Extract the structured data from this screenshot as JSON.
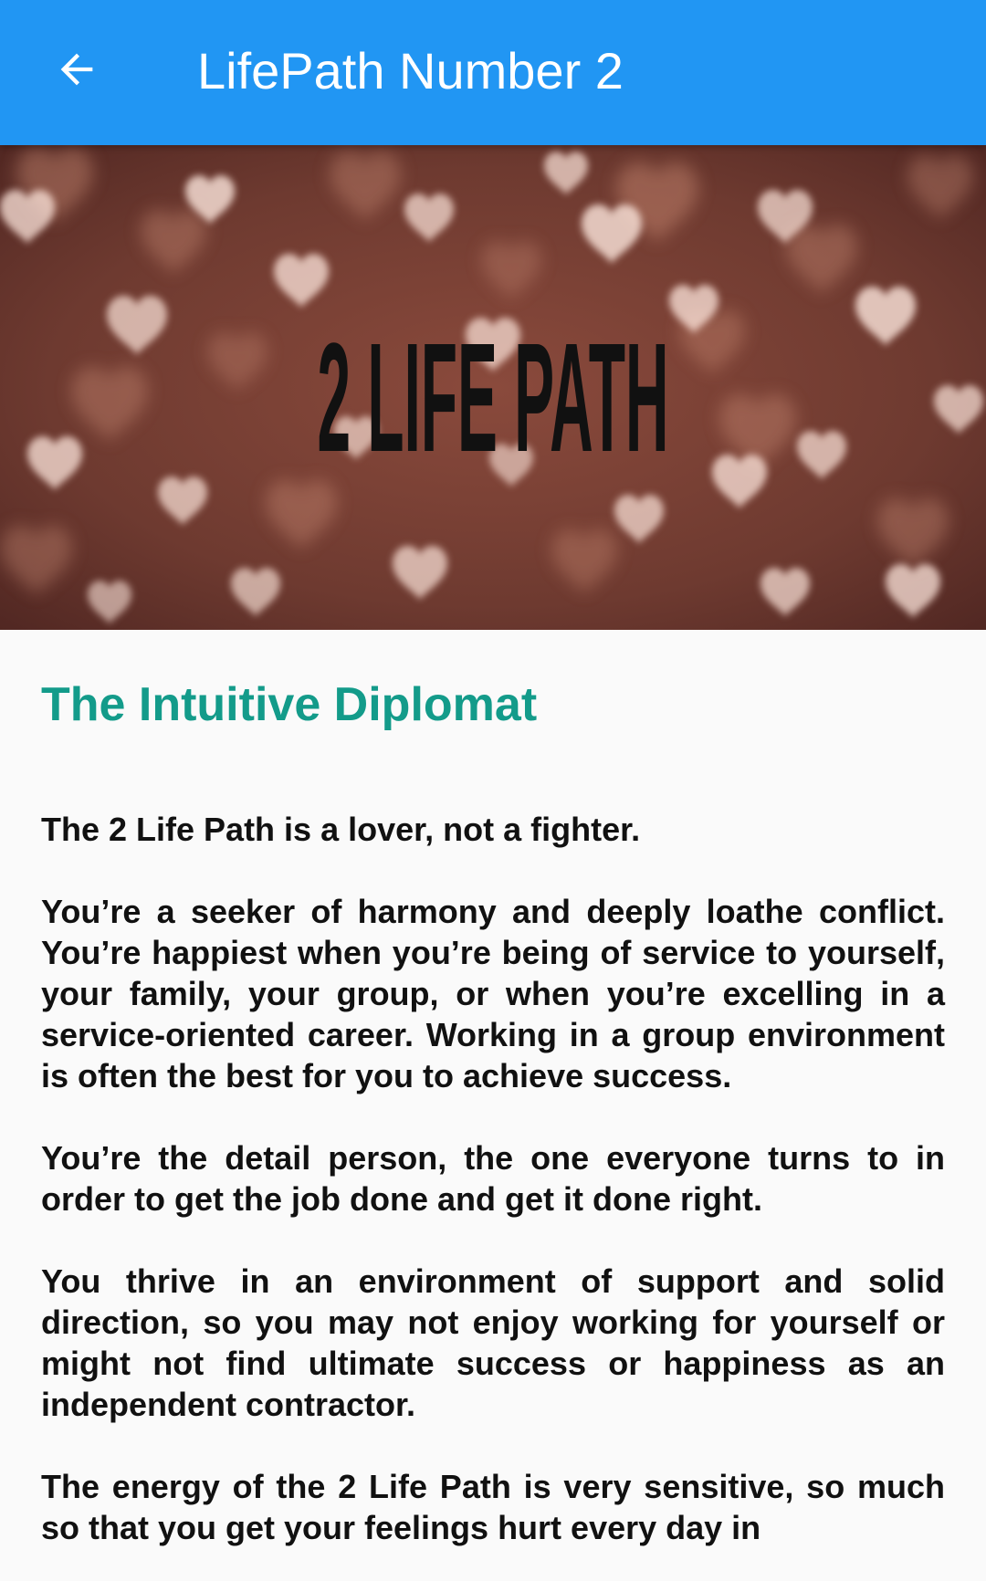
{
  "appbar": {
    "title": "LifePath Number 2",
    "back_icon": "arrow-back-icon",
    "background_color": "#2196f3"
  },
  "hero": {
    "overlay_text": "2 LIFE PATH",
    "theme": "bokeh hearts on rose-brown background"
  },
  "article": {
    "heading": "The Intuitive Diplomat",
    "heading_color": "#139b8a",
    "paragraphs": [
      "The 2 Life Path is a lover, not a fighter.",
      "You’re a seeker of harmony and deeply loathe conflict. You’re happiest when you’re being of service to yourself, your family, your group, or when you’re excelling in a service-oriented career. Working in a group environment is often the best for you to achieve success.",
      "You’re the detail person, the one everyone turns to in order to get the job done and get it done right.",
      "You thrive in an environment of support and solid direction, so you may not enjoy working for yourself or might not find ultimate success or happiness as an independent contractor.",
      "The energy of the 2 Life Path is very sensitive, so much so that you get your feelings hurt every day in"
    ]
  }
}
